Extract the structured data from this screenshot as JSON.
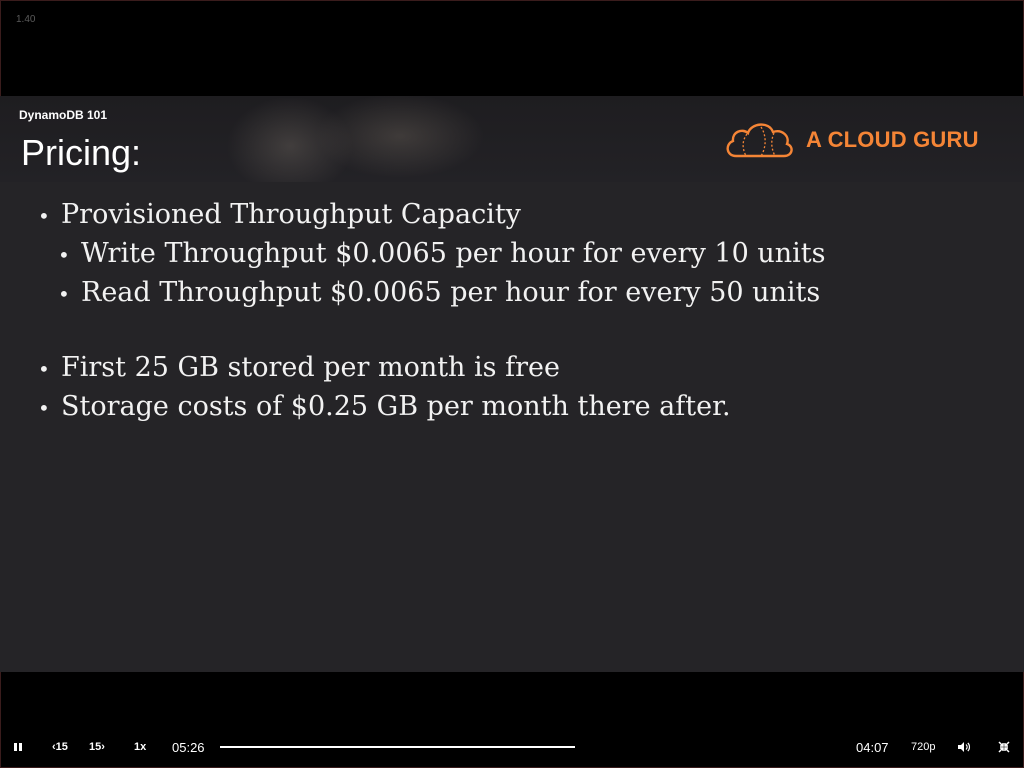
{
  "player": {
    "version": "1.40"
  },
  "slide": {
    "course": "DynamoDB 101",
    "title": "Pricing:",
    "brand": {
      "name": "A CLOUD GURU",
      "color": "#f58536"
    },
    "bullets": [
      {
        "level": 1,
        "text": "Provisioned Throughput Capacity"
      },
      {
        "level": 2,
        "text": "Write Throughput $0.0065 per hour for every 10 units"
      },
      {
        "level": 2,
        "text": "Read Throughput $0.0065 per hour for every 50 units"
      },
      {
        "level": 1,
        "text": "First 25 GB stored per month is free"
      },
      {
        "level": 1,
        "text": "Storage costs of $0.25 GB per month there after."
      }
    ]
  },
  "controls": {
    "play_pause_icon": "pause-icon",
    "rewind_label": "15",
    "forward_label": "15",
    "speed": "1x",
    "elapsed": "05:26",
    "remaining": "04:07",
    "quality": "720p",
    "volume_icon": "volume-icon",
    "fullscreen_icon": "exit-fullscreen-icon"
  }
}
